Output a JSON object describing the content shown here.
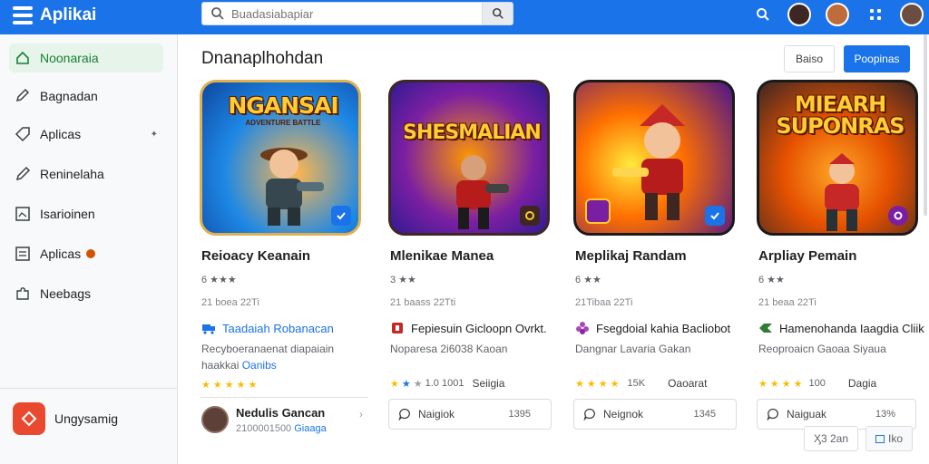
{
  "header": {
    "app_name": "Aplikai",
    "search_placeholder": "Buadasiabapiar"
  },
  "sidebar": {
    "items": [
      {
        "label": "Noonaraia"
      },
      {
        "label": "Bagnadan"
      },
      {
        "label": "Aplicas"
      },
      {
        "label": "Reninelaha"
      },
      {
        "label": "Isarioinen"
      },
      {
        "label": "Aplicas"
      },
      {
        "label": "Neebags"
      }
    ],
    "bottom_app": "Ungysamig"
  },
  "main": {
    "title": "Dnanaplhohdan",
    "btn_outline": "Baiso",
    "btn_primary": "Poopinas"
  },
  "cards": [
    {
      "art_title": "NGANSAI",
      "art_sub": "ADVENTURE BATTLE",
      "name": "Reioacy Keanain",
      "rating": "6 ★★★",
      "meta": "21 boea 22Ti",
      "developer": "Taadaiah Robanacan",
      "desc_line1": "Recyboeranaenat diapaiain",
      "desc_line2_a": "haakkai",
      "desc_line2_b": "Oanibs",
      "stars_value": "",
      "stars_label": "",
      "user_name": "Nedulis Gancan",
      "user_meta_a": "2100001500",
      "user_meta_b": "Giaaga",
      "review_label": "",
      "review_count": ""
    },
    {
      "art_title": "SHESMALIAN",
      "art_sub": "",
      "name": "Mlenikae Manea",
      "rating": "3 ★★",
      "meta": "21 baass 22Tti",
      "developer": "Fepiesuin Gicloopn Ovrkt.",
      "desc_line1": "Noparesa 2i6038 Kaoan",
      "desc_line2_a": "",
      "desc_line2_b": "",
      "stars_value": "1.0 1001",
      "stars_label": "Seiigia",
      "user_name": "",
      "user_meta_a": "",
      "user_meta_b": "",
      "review_label": "Naigiok",
      "review_count": "1395"
    },
    {
      "art_title": "",
      "art_sub": "",
      "name": "Meplikaj Randam",
      "rating": "6 ★★",
      "meta": "21Tibaa 22Ti",
      "developer": "Fsegdoial kahia Bacliobot",
      "desc_line1": "Dangnar Lavaria Gakan",
      "desc_line2_a": "",
      "desc_line2_b": "",
      "stars_value": "15K",
      "stars_label": "Oaoarat",
      "user_name": "",
      "user_meta_a": "",
      "user_meta_b": "",
      "review_label": "Neignok",
      "review_count": "1345"
    },
    {
      "art_title": "MIEARH SUPONRAS",
      "art_sub": "",
      "name": "Arpliay Pemain",
      "rating": "6 ★★",
      "meta": "21 beaa 22Ti",
      "developer": "Hamenohanda Iaagdia Cliik",
      "desc_line1": "Reoproaicn Gaoaa Siyaua",
      "desc_line2_a": "",
      "desc_line2_b": "",
      "stars_value": "100",
      "stars_label": "Dagia",
      "user_name": "",
      "user_meta_a": "",
      "user_meta_b": "",
      "review_label": "Naiguak",
      "review_count": "13%"
    }
  ],
  "footer": {
    "btn_left": "Ӽ3 2an",
    "btn_right": "Iko"
  }
}
